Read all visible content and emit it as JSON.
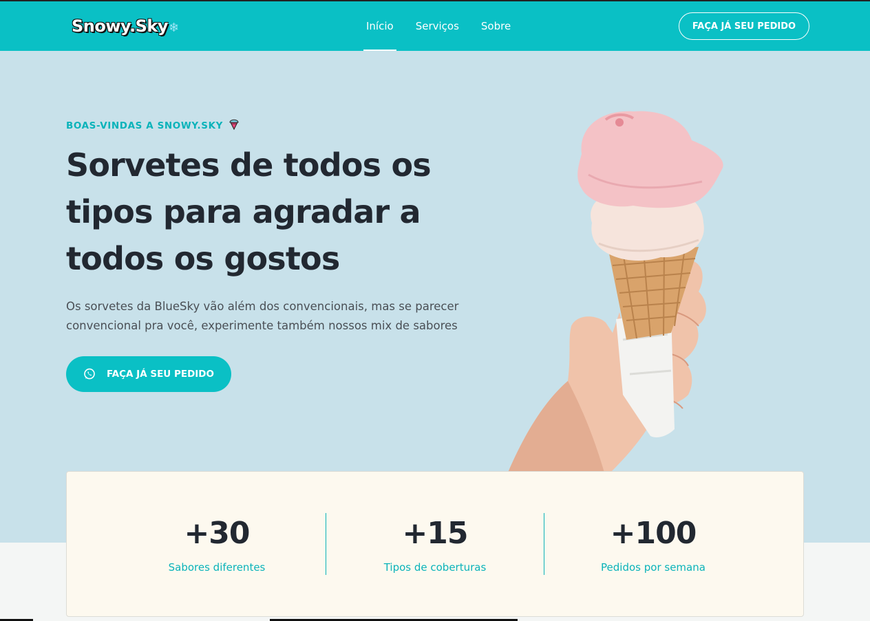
{
  "header": {
    "logo": "Snowy.Sky",
    "logo_glyph": "❄",
    "nav": [
      {
        "label": "Início",
        "active": true
      },
      {
        "label": "Serviços",
        "active": false
      },
      {
        "label": "Sobre",
        "active": false
      }
    ],
    "cta_label": "FAÇA JÁ SEU PEDIDO"
  },
  "hero": {
    "eyebrow": "BOAS-VINDAS A SNOWY.SKY",
    "eyebrow_icon": "ice-cream-icon",
    "title": "Sorvetes de todos os tipos para agradar a todos os gostos",
    "subtitle": "Os sorvetes da BlueSky vão além dos convencionais, mas se parecer convencional pra você, experimente também nossos mix de sabores",
    "cta_label": "FAÇA JÁ SEU PEDIDO",
    "cta_icon": "whatsapp-icon",
    "image": "ice-cream-cone-in-hand"
  },
  "stats": [
    {
      "value": "+30",
      "label": "Sabores diferentes"
    },
    {
      "value": "+15",
      "label": "Tipos de coberturas"
    },
    {
      "value": "+100",
      "label": "Pedidos por semana"
    }
  ],
  "colors": {
    "accent": "#0ac0c5",
    "hero_bg": "#c8e1ea",
    "stats_bg": "#fdf9ef",
    "heading": "#222831"
  }
}
